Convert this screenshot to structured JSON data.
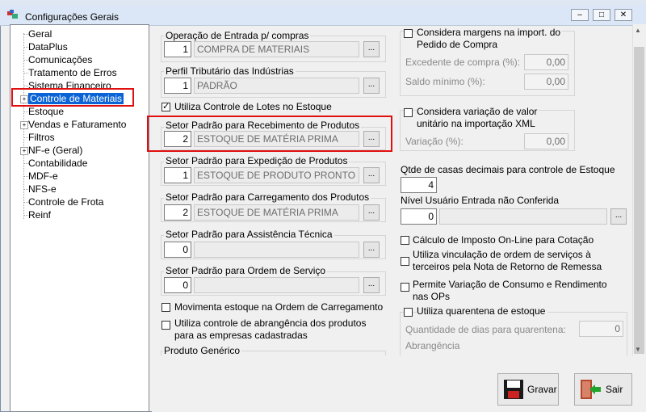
{
  "window": {
    "title": "Configurações Gerais"
  },
  "tree": {
    "items": [
      {
        "label": "Geral"
      },
      {
        "label": "DataPlus"
      },
      {
        "label": "Comunicações"
      },
      {
        "label": "Tratamento de Erros"
      },
      {
        "label": "Sistema Financeiro"
      },
      {
        "label": "Controle de Materiais",
        "selected": true
      },
      {
        "label": "Estoque"
      },
      {
        "label": "Vendas e Faturamento"
      },
      {
        "label": "Filtros"
      },
      {
        "label": "NF-e (Geral)"
      },
      {
        "label": "Contabilidade"
      },
      {
        "label": "MDF-e"
      },
      {
        "label": "NFS-e"
      },
      {
        "label": "Controle de Frota"
      },
      {
        "label": "Reinf"
      }
    ]
  },
  "left": {
    "operacao": {
      "label": "Operação de Entrada p/ compras",
      "code": "1",
      "desc": "COMPRA DE MATERIAIS"
    },
    "perfil": {
      "label": "Perfil Tributário das Indústrias",
      "code": "1",
      "desc": "PADRÃO"
    },
    "lotes": {
      "label": "Utiliza Controle de Lotes no Estoque",
      "checked": true
    },
    "recebimento": {
      "label": "Setor Padrão para Recebimento de Produtos",
      "code": "2",
      "desc": "ESTOQUE DE MATÉRIA PRIMA"
    },
    "expedicao": {
      "label": "Setor Padrão para Expedição de Produtos",
      "code": "1",
      "desc": "ESTOQUE DE PRODUTO PRONTO"
    },
    "carregamento": {
      "label": "Setor Padrão para Carregamento dos Produtos",
      "code": "2",
      "desc": "ESTOQUE DE MATÉRIA PRIMA"
    },
    "assistencia": {
      "label": "Setor Padrão para Assistência Técnica",
      "code": "0",
      "desc": ""
    },
    "ordem": {
      "label": "Setor Padrão para Ordem de Serviço",
      "code": "0",
      "desc": ""
    },
    "movimenta": {
      "label": "Movimenta estoque na Ordem de Carregamento",
      "checked": false
    },
    "abrangencia": {
      "label1": "Utiliza controle de abrangência dos produtos",
      "label2": "para as empresas cadastradas",
      "checked": false
    },
    "produto_generico": {
      "label": "Produto Genérico"
    }
  },
  "right": {
    "margens": {
      "label1": "Considera margens na import. do",
      "label2": "Pedido de Compra",
      "checked": false
    },
    "excedente": {
      "label": "Excedente de compra (%):",
      "value": "0,00"
    },
    "saldo": {
      "label": "Saldo mínimo (%):",
      "value": "0,00"
    },
    "variacao_check": {
      "label1": "Considera variação de valor",
      "label2": "unitário na importação XML",
      "checked": false
    },
    "variacao": {
      "label": "Variação (%):",
      "value": "0,00"
    },
    "decimais": {
      "label": "Qtde de casas decimais para controle de Estoque",
      "value": "4"
    },
    "nivel": {
      "label": "Nível Usuário Entrada não Conferida",
      "code": "0"
    },
    "calculo": {
      "label": "Cálculo de Imposto On-Line para Cotação",
      "checked": false
    },
    "vinculacao": {
      "label1": "Utiliza vinculação de ordem de serviços à",
      "label2": "terceiros pela Nota de Retorno de Remessa",
      "checked": false
    },
    "permite": {
      "label1": "Permite Variação de Consumo e Rendimento",
      "label2": "nas OPs",
      "checked": false
    },
    "quarentena": {
      "label": "Utiliza quarentena de estoque",
      "checked": false
    },
    "quantidade": {
      "label": "Quantidade de dias para quarentena:",
      "value": "0"
    },
    "abrangencia": {
      "label": "Abrangência"
    }
  },
  "buttons": {
    "gravar": "Gravar",
    "sair": "Sair"
  }
}
